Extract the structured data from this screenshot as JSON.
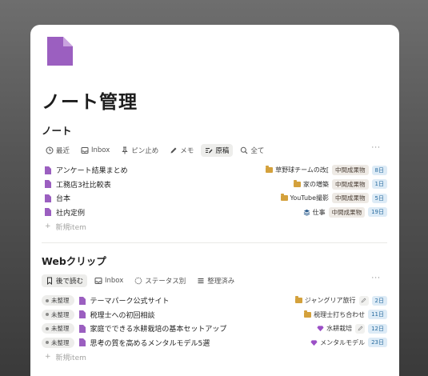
{
  "page": {
    "title": "ノート管理",
    "icon": "document-icon",
    "accent": "#9b5fc0"
  },
  "notes": {
    "title": "ノート",
    "tabs": [
      {
        "label": "最近",
        "icon": "clock-icon",
        "active": false
      },
      {
        "label": "Inbox",
        "icon": "inbox-icon",
        "active": false
      },
      {
        "label": "ピン止め",
        "icon": "pin-icon",
        "active": false
      },
      {
        "label": "メモ",
        "icon": "pen-icon",
        "active": false
      },
      {
        "label": "原稿",
        "icon": "draft-icon",
        "active": true
      },
      {
        "label": "全て",
        "icon": "search-icon",
        "active": false
      }
    ],
    "more": "···",
    "rows": [
      {
        "title": "アンケート結果まとめ",
        "project": "草野球チームの改[",
        "tag": "中間成果物",
        "date": "8日"
      },
      {
        "title": "工務店3社比較表",
        "project": "家の増築",
        "tag": "中間成果物",
        "date": "1日"
      },
      {
        "title": "台本",
        "project": "YouTube撮影",
        "tag": "中間成果物",
        "date": "5日"
      },
      {
        "title": "社内定例",
        "project": "仕事",
        "tag": "中間成果物",
        "date": "19日"
      }
    ],
    "new_item": "新規item"
  },
  "webclips": {
    "title": "Webクリップ",
    "tabs": [
      {
        "label": "後で読む",
        "icon": "bookmark-icon",
        "active": true
      },
      {
        "label": "Inbox",
        "icon": "inbox-icon",
        "active": false
      },
      {
        "label": "ステータス別",
        "icon": "loader-icon",
        "active": false
      },
      {
        "label": "整理済み",
        "icon": "list-icon",
        "active": false
      }
    ],
    "more": "···",
    "rows": [
      {
        "status": "未整理",
        "title": "テーマパーク公式サイト",
        "project": "ジャングリア旅行",
        "date": "2日"
      },
      {
        "status": "未整理",
        "title": "税理士への初回相談",
        "project": "税理士打ち合わせ",
        "date": "11日"
      },
      {
        "status": "未整理",
        "title": "家庭でできる水耕栽培の基本セットアップ",
        "project": "水耕栽培",
        "date": "12日"
      },
      {
        "status": "未整理",
        "title": "思考の質を高めるメンタルモデル5選",
        "project": "メンタルモデル",
        "date": "23日"
      }
    ],
    "new_item": "新規item"
  }
}
